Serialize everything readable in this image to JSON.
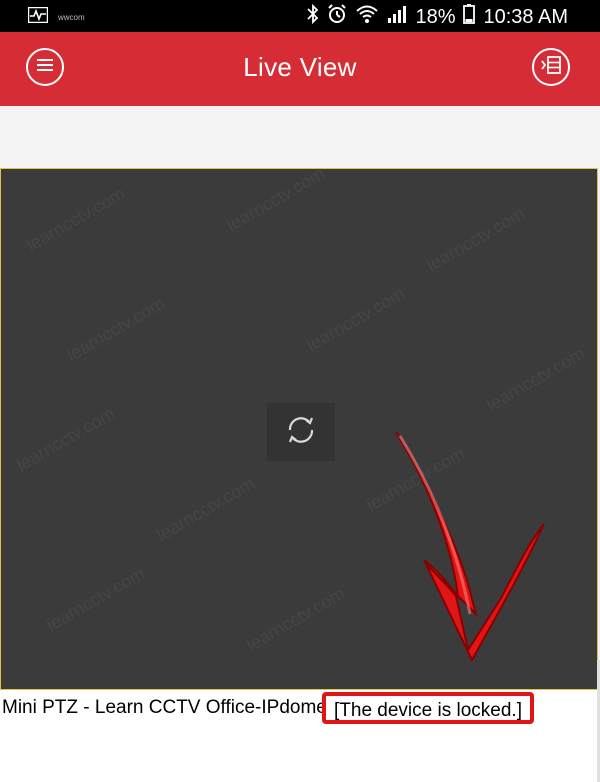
{
  "status_bar": {
    "carrier_small": "wwcom",
    "battery_percent": "18%",
    "time": "10:38 AM",
    "icons": [
      "activity-icon",
      "bluetooth-icon",
      "alarm-icon",
      "wifi-icon",
      "signal-icon",
      "battery-icon"
    ]
  },
  "app_bar": {
    "title": "Live View",
    "menu_icon": "menu-icon",
    "layout_icon": "layout-list-icon",
    "color": "#d62c35"
  },
  "video": {
    "watermark": "learncctv.com",
    "loader_icon": "refresh-icon",
    "annotation_color": "#e01616"
  },
  "caption": {
    "device_name": "Mini PTZ - Learn CCTV Office-IPdome",
    "status": "[The device is locked.]"
  }
}
